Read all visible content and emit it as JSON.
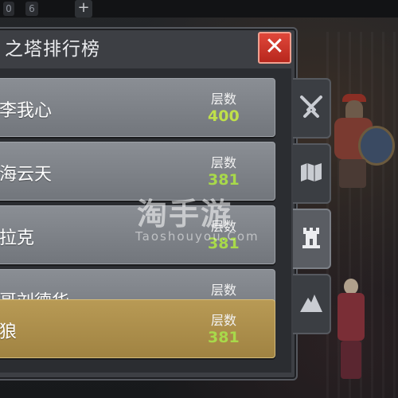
{
  "topbar": {
    "slot_a": "0",
    "slot_b": "6",
    "plus": "+"
  },
  "panel": {
    "title": "之塔排行榜",
    "close": "✕"
  },
  "floor_label": "层数",
  "rows": [
    {
      "name": "李我心",
      "floor_label": "层数",
      "floor": "400",
      "highlight": false
    },
    {
      "name": "海云天",
      "floor_label": "层数",
      "floor": "381",
      "highlight": false
    },
    {
      "name": "拉克",
      "floor_label": "层数",
      "floor": "381",
      "highlight": false
    },
    {
      "name": "哥刘德华",
      "floor_label": "层数",
      "floor": "",
      "highlight": false
    },
    {
      "name": "狼",
      "floor_label": "层数",
      "floor": "381",
      "highlight": true
    }
  ],
  "tabs": [
    {
      "icon": "crossed-swords-icon",
      "active": false
    },
    {
      "icon": "map-icon",
      "active": false
    },
    {
      "icon": "tower-icon",
      "active": true
    },
    {
      "icon": "mountain-icon",
      "active": false
    }
  ],
  "watermark": {
    "main": "淘手游",
    "sub": "Taoshouyou.Com"
  },
  "colors": {
    "floor_value": "#a8d94a",
    "highlight_row": "#b89a55",
    "close_button": "#d0382c"
  }
}
